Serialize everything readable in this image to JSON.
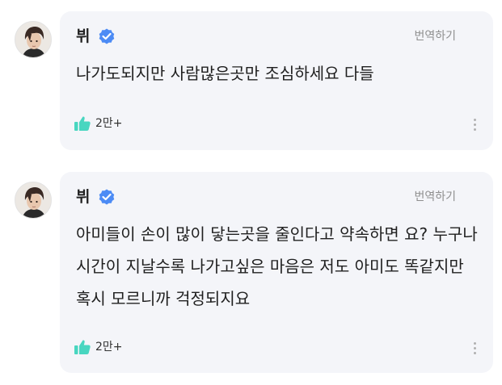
{
  "posts": [
    {
      "author": "뷔",
      "verified_icon": "verified-check-icon",
      "translate_label": "번역하기",
      "text": "나가도되지만 사람많은곳만 조심하세요 다들",
      "like_icon": "thumbs-up-icon",
      "like_count": "2만+",
      "more_icon": "more-vertical-icon"
    },
    {
      "author": "뷔",
      "verified_icon": "verified-check-icon",
      "translate_label": "번역하기",
      "text": "아미들이 손이 많이 닿는곳을 줄인다고 약속하면 요? 누구나 시간이 지날수록 나가고싶은 마음은 저도 아미도 똑같지만 혹시 모르니까 걱정되지요",
      "like_icon": "thumbs-up-icon",
      "like_count": "2만+",
      "more_icon": "more-vertical-icon"
    }
  ],
  "colors": {
    "bubble_bg": "#f4f5f9",
    "verified_blue": "#4c8bf5",
    "like_mint": "#48d6c0",
    "muted_text": "#8e8e8e"
  }
}
